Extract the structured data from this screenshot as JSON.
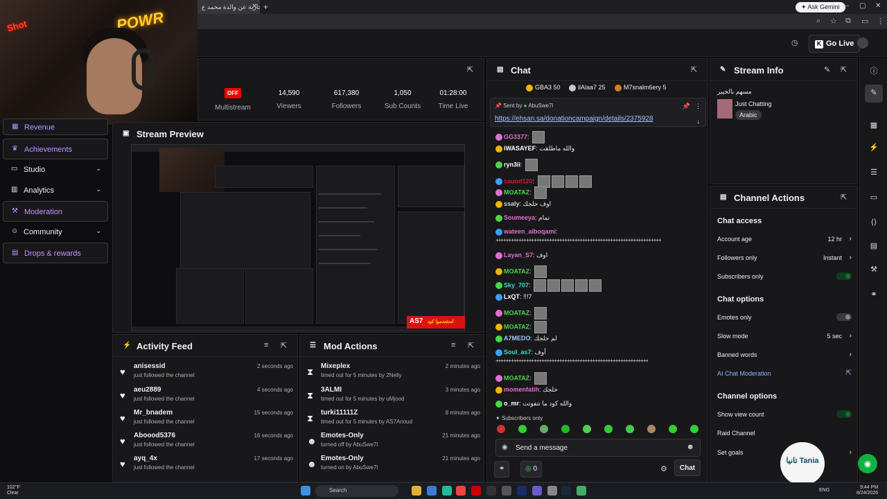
{
  "browser": {
    "tab_title": "صدقة جارية عن والدة محمد ع",
    "ask_gemini": "Ask Gemini"
  },
  "topbar": {
    "go_live": "Go Live"
  },
  "webcam": {
    "neon_text": "POWR",
    "neon_text2": "Shot"
  },
  "sidebar": {
    "items": [
      {
        "label": "Revenue",
        "icon": "revenue-icon",
        "boxed": true
      },
      {
        "label": "Achievements",
        "icon": "achievements-icon",
        "boxed": true
      },
      {
        "label": "Studio",
        "icon": "studio-icon",
        "chevron": true
      },
      {
        "label": "Analytics",
        "icon": "analytics-icon",
        "chevron": true
      },
      {
        "label": "Moderation",
        "icon": "moderation-icon",
        "boxed": true
      },
      {
        "label": "Community",
        "icon": "community-icon",
        "chevron": true
      },
      {
        "label": "Drops & rewards",
        "icon": "drops-icon",
        "boxed": true
      }
    ]
  },
  "stats": {
    "off_badge": "OFF",
    "multistream": "Multistream",
    "viewers": {
      "value": "14,590",
      "label": "Viewers"
    },
    "followers": {
      "value": "617,380",
      "label": "Followers"
    },
    "subs": {
      "value": "1,050",
      "label": "Sub Counts"
    },
    "time": {
      "value": "01:28:00",
      "label": "Time Live"
    }
  },
  "preview": {
    "title": "Stream Preview",
    "banner_main": "AS7",
    "banner_sub": "استعدموا كود"
  },
  "activity": {
    "title": "Activity Feed",
    "rows": [
      {
        "user": "anisessid",
        "sub": "just followed the channel",
        "time": "2 seconds ago"
      },
      {
        "user": "aeu2889",
        "sub": "just followed the channel",
        "time": "4 seconds ago"
      },
      {
        "user": "Mr_bnadem",
        "sub": "just followed the channel",
        "time": "15 seconds ago"
      },
      {
        "user": "Aboood5376",
        "sub": "just followed the channel",
        "time": "16 seconds ago"
      },
      {
        "user": "ayq_4x",
        "sub": "just followed the channel",
        "time": "17 seconds ago"
      }
    ]
  },
  "mod": {
    "title": "Mod Actions",
    "rows": [
      {
        "user": "Mixeplex",
        "sub": "timed out for 5 minutes by 2Nelly",
        "time": "2 minutes ago",
        "icon": "hourglass-icon"
      },
      {
        "user": "3ALMI",
        "sub": "timed out for 5 minutes by uMjood",
        "time": "3 minutes ago",
        "icon": "hourglass-icon"
      },
      {
        "user": "turki11111Z",
        "sub": "timed out for 5 minutes by AS7Anoud",
        "time": "8 minutes ago",
        "icon": "hourglass-icon"
      },
      {
        "user": "Emotes-Only",
        "sub": "turned off by AbuSwe7l",
        "time": "21 minutes ago",
        "icon": "smiley-icon"
      },
      {
        "user": "Emotes-Only",
        "sub": "turned on by AbuSwe7l",
        "time": "21 minutes ago",
        "icon": "smiley-icon"
      }
    ]
  },
  "chat": {
    "title": "Chat",
    "top_chatters": [
      {
        "name": "GBA3",
        "count": "50",
        "color": "#f2b600"
      },
      {
        "name": "ilAlaa7",
        "count": "25",
        "color": "#c8c8c8"
      },
      {
        "name": "M7snalm6ery",
        "count": "5",
        "color": "#d67a2a"
      }
    ],
    "pinned": {
      "sent_by": "Sent by",
      "by_user": "AbuSwe7l",
      "link": "https://ehsan.sa/donationcampaign/details/2375928"
    },
    "messages": [
      {
        "name": "GG3377",
        "color": "#e070d0",
        "text": "",
        "emotes": 1
      },
      {
        "name": "iWASAYEF",
        "color": "#ffffff",
        "text": "والله ماطلقت",
        "emotes": 0
      },
      {
        "name": "ryn3ii",
        "color": "#ffffff",
        "text": "",
        "emotes": 1
      },
      {
        "name": "sauod120",
        "color": "#d01a2a",
        "text": "",
        "emotes": 4
      },
      {
        "name": "MOATAZ",
        "color": "#4bd64b",
        "text": "",
        "emotes": 1
      },
      {
        "name": "ssaly",
        "color": "#cfcfcf",
        "text": "اوف حلجك",
        "emotes": 0
      },
      {
        "name": "Soumeeya",
        "color": "#e070d0",
        "text": "تمام",
        "emotes": 0
      },
      {
        "name": "wateen_alboqami",
        "color": "#e070d0",
        "text": "",
        "emotes": 0
      },
      {
        "name": "Layan_S7",
        "color": "#e070d0",
        "text": "اوف",
        "emotes": 0
      },
      {
        "name": "MOATAZ",
        "color": "#4bd64b",
        "text": "",
        "emotes": 1
      },
      {
        "name": "Sky_707",
        "color": "#4bd6c8",
        "text": "",
        "emotes": 5
      },
      {
        "name": "LxQT",
        "color": "#ffffff",
        "text": "!!!7",
        "emotes": 0
      },
      {
        "name": "MOATAZ",
        "color": "#4bd64b",
        "text": "",
        "emotes": 1
      },
      {
        "name": "MOATAZ",
        "color": "#4bd64b",
        "text": "",
        "emotes": 1
      },
      {
        "name": "A7MEDO",
        "color": "#a3c6ff",
        "text": "لم حلجك",
        "emotes": 0
      },
      {
        "name": "Soul_as7",
        "color": "#4bd6c8",
        "text": "أوف",
        "emotes": 0
      },
      {
        "name": "MOATAZ",
        "color": "#4bd64b",
        "text": "",
        "emotes": 1
      },
      {
        "name": "momenfatih",
        "color": "#e070d0",
        "text": "حلجك",
        "emotes": 0
      },
      {
        "name": "o_mr",
        "color": "#ffffff",
        "text": "والله كود ما تتفوتت",
        "emotes": 0
      }
    ],
    "dashes": "+++++++++++++++++++++++++++++++++++++++++++++++++++++++++++++++++",
    "subs_only": "Subscribers only",
    "placeholder": "Send a message",
    "points": "0",
    "chat_button": "Chat"
  },
  "stream_info": {
    "title": "Stream Info",
    "stream_title": "مسهم بالخيير",
    "category": "Just Chatting",
    "language": "Arabic"
  },
  "channel_actions": {
    "title": "Channel Actions",
    "chat_access": "Chat access",
    "account_age": {
      "label": "Account age",
      "value": "12 hr"
    },
    "followers_only": {
      "label": "Followers only",
      "value": "Instant"
    },
    "subscribers_only": {
      "label": "Subscribers only",
      "on": true
    },
    "chat_options": "Chat options",
    "emotes_only": {
      "label": "Emotes only",
      "on": false
    },
    "slow_mode": {
      "label": "Slow mode",
      "value": "5 sec"
    },
    "banned_words": {
      "label": "Banned words"
    },
    "ai_mod": {
      "label": "AI Chat Moderation"
    },
    "channel_options": "Channel options",
    "show_view_count": {
      "label": "Show view count",
      "on": true
    },
    "raid_channel": {
      "label": "Raid Channel"
    },
    "set_goals": {
      "label": "Set goals"
    }
  },
  "taskbar": {
    "temp": "102°F",
    "weather": "Clear",
    "search": "Search",
    "lang": "ENG",
    "time": "9:44 PM",
    "date": "8/24/2026"
  },
  "watermark": {
    "text": "تانيا Tania"
  },
  "colors": {
    "accent": "#bf94ff",
    "live_red": "#eb0400",
    "green": "#10b13f"
  }
}
